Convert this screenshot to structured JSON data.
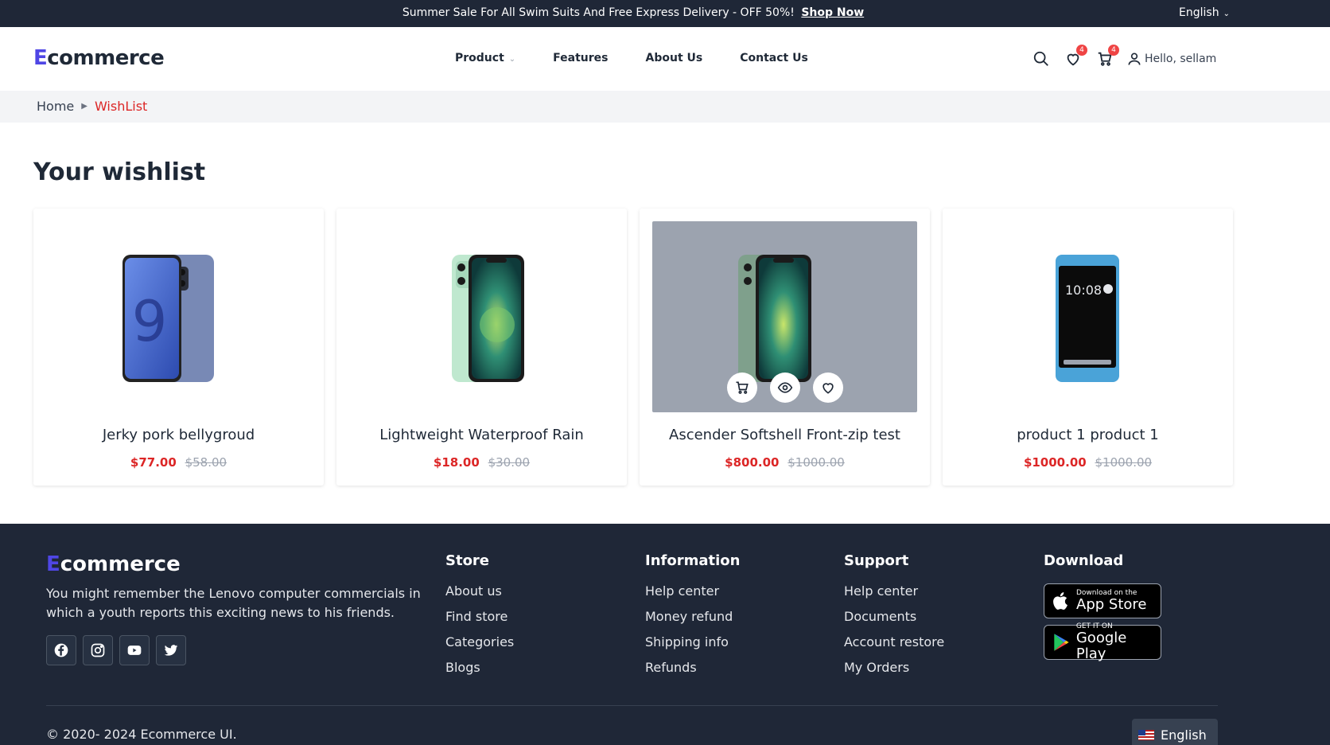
{
  "topbar": {
    "promo_text": "Summer Sale For All Swim Suits And Free Express Delivery - OFF 50%!",
    "promo_link": "Shop Now",
    "language": "English"
  },
  "header": {
    "logo_initial": "E",
    "logo_rest": "commerce",
    "nav": [
      {
        "label": "Product"
      },
      {
        "label": "Features"
      },
      {
        "label": "About Us"
      },
      {
        "label": "Contact Us"
      }
    ],
    "wishlist_count": "4",
    "cart_count": "4",
    "user_greeting": "Hello, sellam"
  },
  "breadcrumb": {
    "home": "Home",
    "current": "WishList"
  },
  "page_title": "Your wishlist",
  "products": [
    {
      "name": "Jerky pork bellygroud",
      "price": "$77.00",
      "old_price": "$58.00",
      "image": "samsung-galaxy-s9"
    },
    {
      "name": "Lightweight Waterproof Rain",
      "price": "$18.00",
      "old_price": "$30.00",
      "image": "iphone-12-green"
    },
    {
      "name": "Ascender Softshell Front-zip test",
      "price": "$800.00",
      "old_price": "$1000.00",
      "image": "iphone-12-green"
    },
    {
      "name": "product 1 product 1",
      "price": "$1000.00",
      "old_price": "$1000.00",
      "image": "htc-one-blue",
      "clock": "10:08"
    }
  ],
  "footer": {
    "logo_initial": "E",
    "logo_rest": "commerce",
    "description": "You might remember the Lenovo computer commercials in which a youth reports this exciting news to his friends.",
    "socials": [
      "facebook-icon",
      "instagram-icon",
      "youtube-icon",
      "twitter-icon"
    ],
    "columns": [
      {
        "title": "Store",
        "links": [
          "About us",
          "Find store",
          "Categories",
          "Blogs"
        ]
      },
      {
        "title": "Information",
        "links": [
          "Help center",
          "Money refund",
          "Shipping info",
          "Refunds"
        ]
      },
      {
        "title": "Support",
        "links": [
          "Help center",
          "Documents",
          "Account restore",
          "My Orders"
        ]
      }
    ],
    "download": {
      "title": "Download",
      "appstore_small": "Download on the",
      "appstore_big": "App Store",
      "googleplay_small": "GET IT ON",
      "googleplay_big": "Google Play"
    },
    "copyright": "© 2020- 2024 Ecommerce UI.",
    "language": "English"
  },
  "colors": {
    "dark_bg": "#1f2737",
    "accent": "#4f46e5",
    "price_red": "#dc2626"
  }
}
